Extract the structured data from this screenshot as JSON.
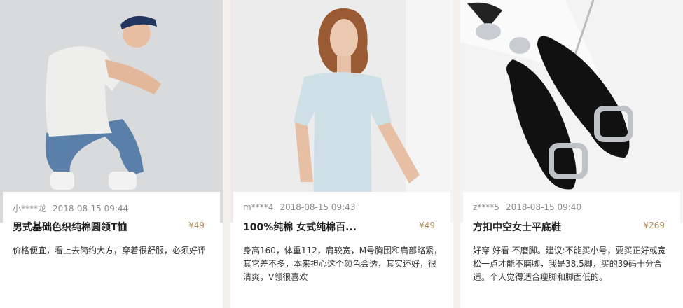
{
  "reviews": [
    {
      "user": "小****龙",
      "datetime": "2018-08-15 09:44",
      "title": "男式基础色织纯棉圆领T恤",
      "price": "¥49",
      "comment": "价格便宜，看上去简约大方，穿着很舒服，必须好评"
    },
    {
      "user": "m****4",
      "datetime": "2018-08-15 09:43",
      "title": "100%纯棉 女式纯棉百...",
      "price": "¥49",
      "comment": "身高160，体重112，肩较宽，M号胸围和肩部略紧，其它差不多，本来担心这个颜色会透，其实还好，很清爽，V领很喜欢"
    },
    {
      "user": "z****5",
      "datetime": "2018-08-15 09:40",
      "title": "方扣中空女士平底鞋",
      "price": "¥269",
      "comment": "好穿 好看 不磨脚。建议:不能买小号，要买正好或宽松一点才能不磨脚，我是38.5脚，买的39码十分合适。个人觉得适合瘦脚和脚面低的。"
    }
  ],
  "colors": {
    "price": "#b28d59",
    "meta": "#8c8c8c",
    "background": "#f4f1ec"
  }
}
